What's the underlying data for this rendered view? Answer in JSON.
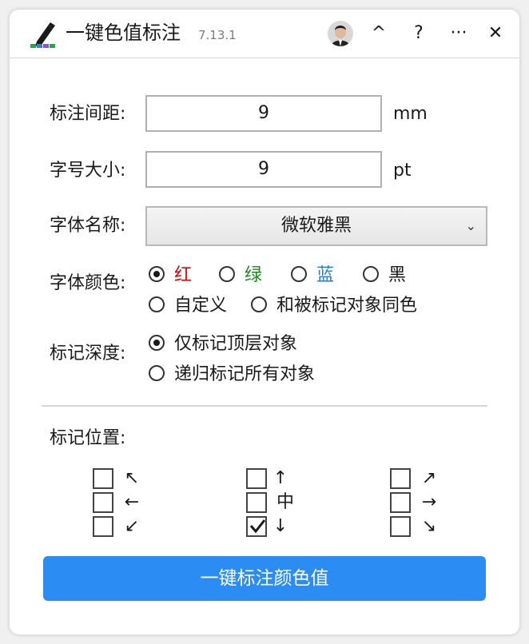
{
  "titlebar": {
    "title": "一键色值标注",
    "version": "7.13.1",
    "buttons": {
      "collapse": "^",
      "help": "?",
      "more": "···",
      "close": "✕"
    }
  },
  "form": {
    "spacing": {
      "label": "标注间距:",
      "value": "9",
      "unit": "mm"
    },
    "font_size": {
      "label": "字号大小:",
      "value": "9",
      "unit": "pt"
    },
    "font_name": {
      "label": "字体名称:",
      "value": "微软雅黑"
    },
    "font_color": {
      "label": "字体颜色:",
      "options": [
        {
          "label": "红",
          "color": "#e00000",
          "checked": true
        },
        {
          "label": "绿",
          "color": "#1a8a1a",
          "checked": false
        },
        {
          "label": "蓝",
          "color": "#1e7fe0",
          "checked": false
        },
        {
          "label": "黑",
          "color": "#1a1a1a",
          "checked": false
        },
        {
          "label": "自定义",
          "color": "#1a1a1a",
          "checked": false
        },
        {
          "label": "和被标记对象同色",
          "color": "#1a1a1a",
          "checked": false
        }
      ]
    },
    "depth": {
      "label": "标记深度:",
      "options": [
        {
          "label": "仅标记顶层对象",
          "checked": true
        },
        {
          "label": "递归标记所有对象",
          "checked": false
        }
      ]
    },
    "position": {
      "label": "标记位置:",
      "items": [
        {
          "glyph": "↖",
          "checked": false
        },
        {
          "glyph": "←",
          "checked": false
        },
        {
          "glyph": "↙",
          "checked": false
        },
        {
          "glyph": "↑",
          "checked": false
        },
        {
          "glyph": "中",
          "checked": false
        },
        {
          "glyph": "↓",
          "checked": true
        },
        {
          "glyph": "↗",
          "checked": false
        },
        {
          "glyph": "→",
          "checked": false
        },
        {
          "glyph": "↘",
          "checked": false
        }
      ]
    }
  },
  "action": {
    "label": "一键标注颜色值"
  },
  "colors": {
    "accent": "#2b8cf4"
  }
}
